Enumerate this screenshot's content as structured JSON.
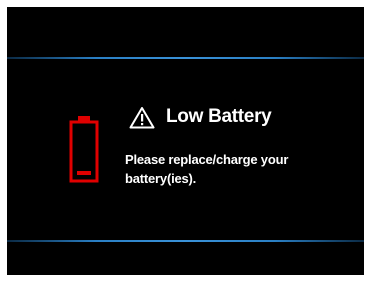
{
  "dialog": {
    "title": "Low Battery",
    "message": "Please replace/charge your battery(ies).",
    "title_icon": "warning-triangle-icon",
    "status_icon": "battery-low-icon"
  },
  "colors": {
    "background": "#000000",
    "text": "#ffffff",
    "accent_rule": "#3a92d8",
    "battery_warning": "#e00000"
  }
}
